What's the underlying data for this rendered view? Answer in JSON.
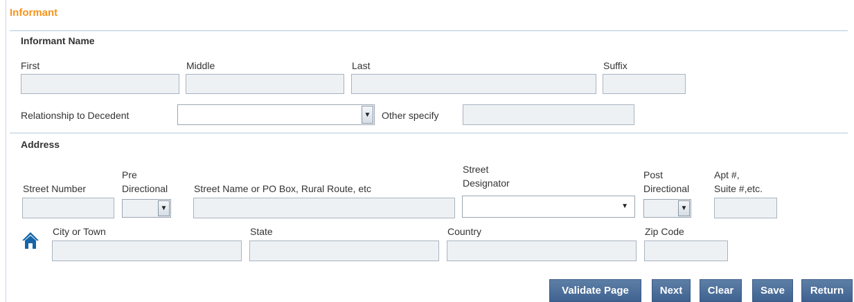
{
  "section_title": "Informant",
  "informant_name": {
    "heading": "Informant Name",
    "first_label": "First",
    "middle_label": "Middle",
    "last_label": "Last",
    "suffix_label": "Suffix",
    "relationship_label": "Relationship to Decedent",
    "other_specify_label": "Other specify"
  },
  "address": {
    "heading": "Address",
    "street_number_label": "Street Number",
    "pre_directional_label_1": "Pre",
    "pre_directional_label_2": "Directional",
    "street_name_label": "Street Name or PO Box, Rural Route, etc",
    "street_designator_label_1": "Street",
    "street_designator_label_2": "Designator",
    "post_directional_label_1": "Post",
    "post_directional_label_2": "Directional",
    "apt_label_1": "Apt #,",
    "apt_label_2": "Suite #,etc.",
    "city_label": "City or Town",
    "state_label": "State",
    "country_label": "Country",
    "zip_label": "Zip Code",
    "home_icon": "home-icon"
  },
  "buttons": {
    "validate": "Validate Page",
    "next": "Next",
    "clear": "Clear",
    "save": "Save",
    "return": "Return"
  },
  "colors": {
    "section_title": "#f7941d",
    "button_bg": "#4a6c98",
    "field_bg": "#eef1f4",
    "home_icon": "#1565a8"
  }
}
